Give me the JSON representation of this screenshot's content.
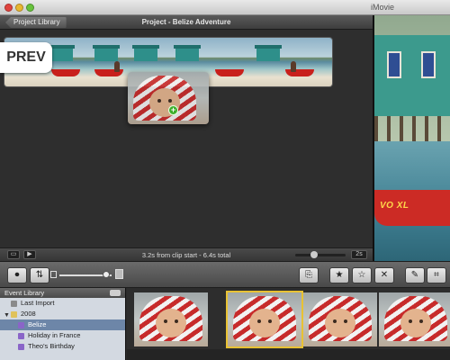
{
  "window": {
    "title": "iMovie"
  },
  "project": {
    "library_button": "Project Library",
    "title": "Project - Belize Adventure",
    "badge": "PREV",
    "status": "3.2s from clip start - 6.4s total",
    "zoom_label": "2s",
    "zoom_level": 0.35,
    "drag_badge": "+"
  },
  "viewer": {
    "boat_text": "VO XL"
  },
  "toolbar": {
    "size_slider_level": 0.95
  },
  "event_library": {
    "heading": "Event Library",
    "items": [
      {
        "label": "Last Import",
        "icon": "star-icon",
        "indent": 1,
        "selected": false
      },
      {
        "label": "2008",
        "icon": "folder-icon",
        "indent": 1,
        "selected": false
      },
      {
        "label": "Belize",
        "icon": "event-icon",
        "indent": 2,
        "selected": true
      },
      {
        "label": "Holiday in France",
        "icon": "event-icon",
        "indent": 2,
        "selected": false
      },
      {
        "label": "Theo's Birthday",
        "icon": "event-icon",
        "indent": 2,
        "selected": false
      }
    ]
  },
  "colors": {
    "accent_selection": "#e8c233",
    "sidebar_selection": "#6d86a8"
  }
}
